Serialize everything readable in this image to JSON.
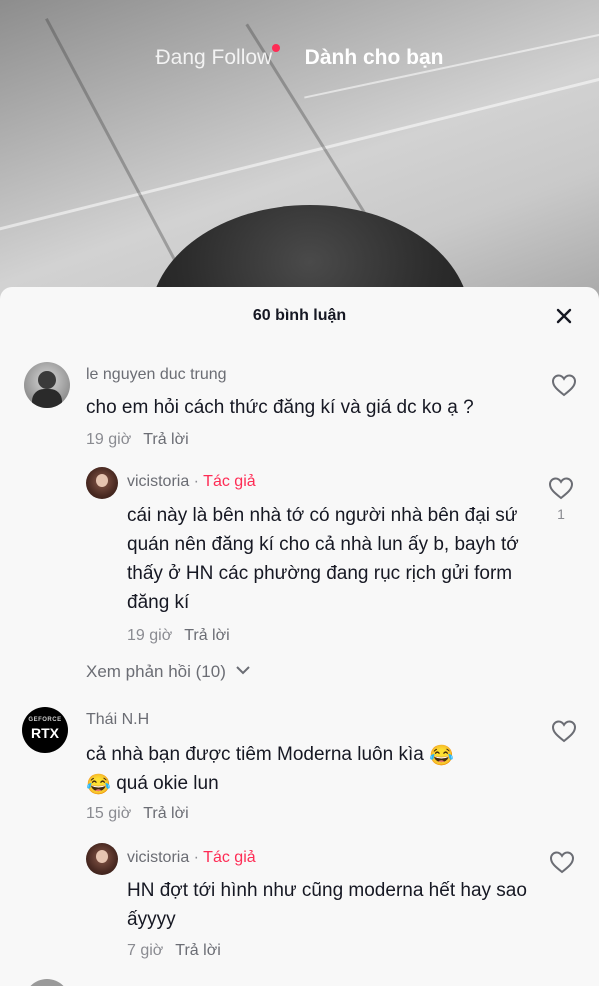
{
  "tabs": {
    "following": "Đang Follow",
    "for_you": "Dành cho bạn"
  },
  "colors": {
    "accent": "#fe2c55"
  },
  "sheet": {
    "title": "60 bình luận",
    "close_icon": "close-icon"
  },
  "reply_label": "Trả lời",
  "comments": [
    {
      "username": "le nguyen duc trung",
      "text": "cho em hỏi cách thức đăng kí và giá dc ko ạ ?",
      "time": "19 giờ",
      "replies": [
        {
          "username": "vicistoria",
          "author_tag": "Tác giả",
          "text": "cái này là bên nhà tớ có người nhà bên đại sứ quán nên đăng kí cho cả nhà lun ấy b, bayh tớ thấy ở HN các phường đang rục rịch gửi form đăng kí",
          "time": "19 giờ",
          "likes": "1"
        }
      ],
      "view_replies": "Xem phản hồi (10)"
    },
    {
      "username": "Thái N.H",
      "avatar_text": "RTX",
      "avatar_subtext": "GEFORCE",
      "text_part1": "cả nhà bạn được tiêm Moderna luôn kìa",
      "text_part2": "quá okie lun",
      "emoji": "😂",
      "time": "15 giờ",
      "replies": [
        {
          "username": "vicistoria",
          "author_tag": "Tác giả",
          "text": "HN đợt tới hình như cũng moderna hết hay sao ấyyyy",
          "time": "7 giờ"
        }
      ]
    }
  ]
}
